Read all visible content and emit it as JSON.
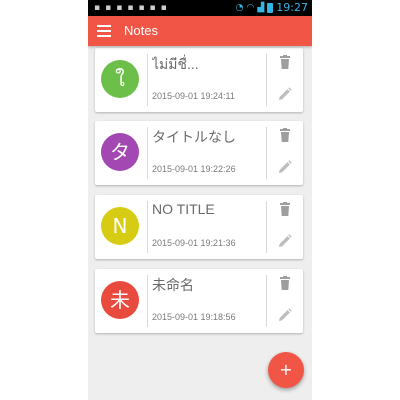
{
  "status_bar": {
    "time": "19:27"
  },
  "toolbar": {
    "title": "Notes"
  },
  "notes": [
    {
      "initial": "ใ",
      "title": "ไม่มีชื่...",
      "date": "2015-09-01 19:24:11",
      "color": "#6cc04a"
    },
    {
      "initial": "タ",
      "title": "タイトルなし",
      "date": "2015-09-01 19:22:26",
      "color": "#a347b3"
    },
    {
      "initial": "N",
      "title": "NO TITLE",
      "date": "2015-09-01 19:21:36",
      "color": "#d6cc13"
    },
    {
      "initial": "未",
      "title": "未命名",
      "date": "2015-09-01 19:18:56",
      "color": "#e94a3e"
    }
  ],
  "fab": {
    "label": "+"
  },
  "colors": {
    "accent": "#f05545",
    "background": "#eeeeee",
    "status_time": "#33b5e5"
  },
  "icons": [
    "menu-icon",
    "trash-icon",
    "edit-icon",
    "add-icon"
  ]
}
